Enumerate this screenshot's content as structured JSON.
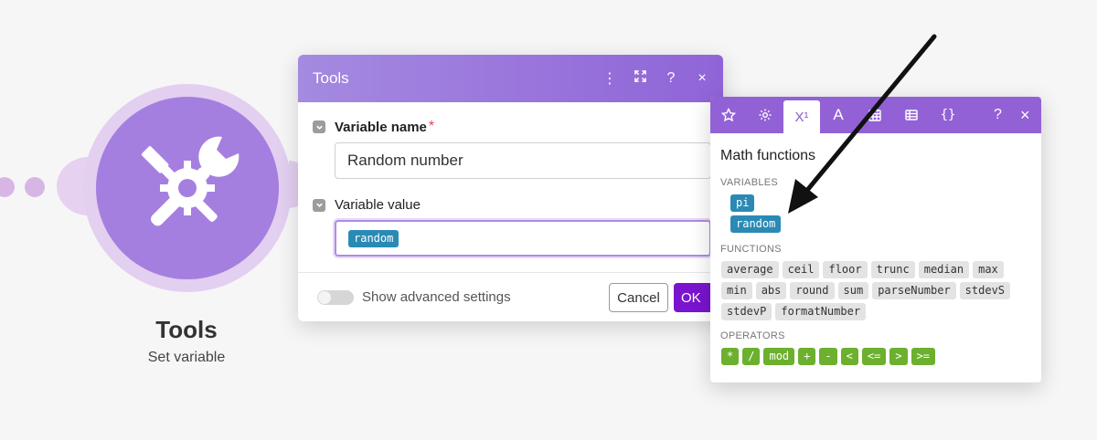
{
  "module": {
    "title": "Tools",
    "subtitle": "Set variable",
    "color": "#a57fdf"
  },
  "dialog": {
    "title": "Tools",
    "header_icons": [
      "more-vertical-icon",
      "expand-icon",
      "help-icon",
      "close-icon"
    ],
    "help_symbol": "?",
    "close_symbol": "×",
    "more_symbol": "⋮",
    "variable_name": {
      "label": "Variable name",
      "required_mark": "*",
      "value": "Random number"
    },
    "variable_value": {
      "label": "Variable value",
      "pill": "random"
    },
    "advanced_toggle_label": "Show advanced settings",
    "cancel_label": "Cancel",
    "ok_label": "OK",
    "accent": "#7a14ce"
  },
  "panel": {
    "title": "Math functions",
    "tabs": [
      "star-icon",
      "gear-icon",
      "math-icon",
      "text-icon",
      "calendar-icon",
      "table-icon",
      "json-icon"
    ],
    "math_tab_label": "X¹",
    "text_tab_label": "A",
    "json_tab_label": "{}",
    "help_symbol": "?",
    "close_symbol": "×",
    "variables_label": "VARIABLES",
    "variables": [
      "pi",
      "random"
    ],
    "functions_label": "FUNCTIONS",
    "functions": [
      "average",
      "ceil",
      "floor",
      "trunc",
      "median",
      "max",
      "min",
      "abs",
      "round",
      "sum",
      "parseNumber",
      "stdevS",
      "stdevP",
      "formatNumber"
    ],
    "operators_label": "OPERATORS",
    "operators": [
      "*",
      "/",
      "mod",
      "+",
      "-",
      "<",
      "<=",
      ">",
      ">="
    ],
    "header_color": "#9361d6",
    "variable_color": "#2a8ab5",
    "operator_color": "#6cb02e"
  }
}
